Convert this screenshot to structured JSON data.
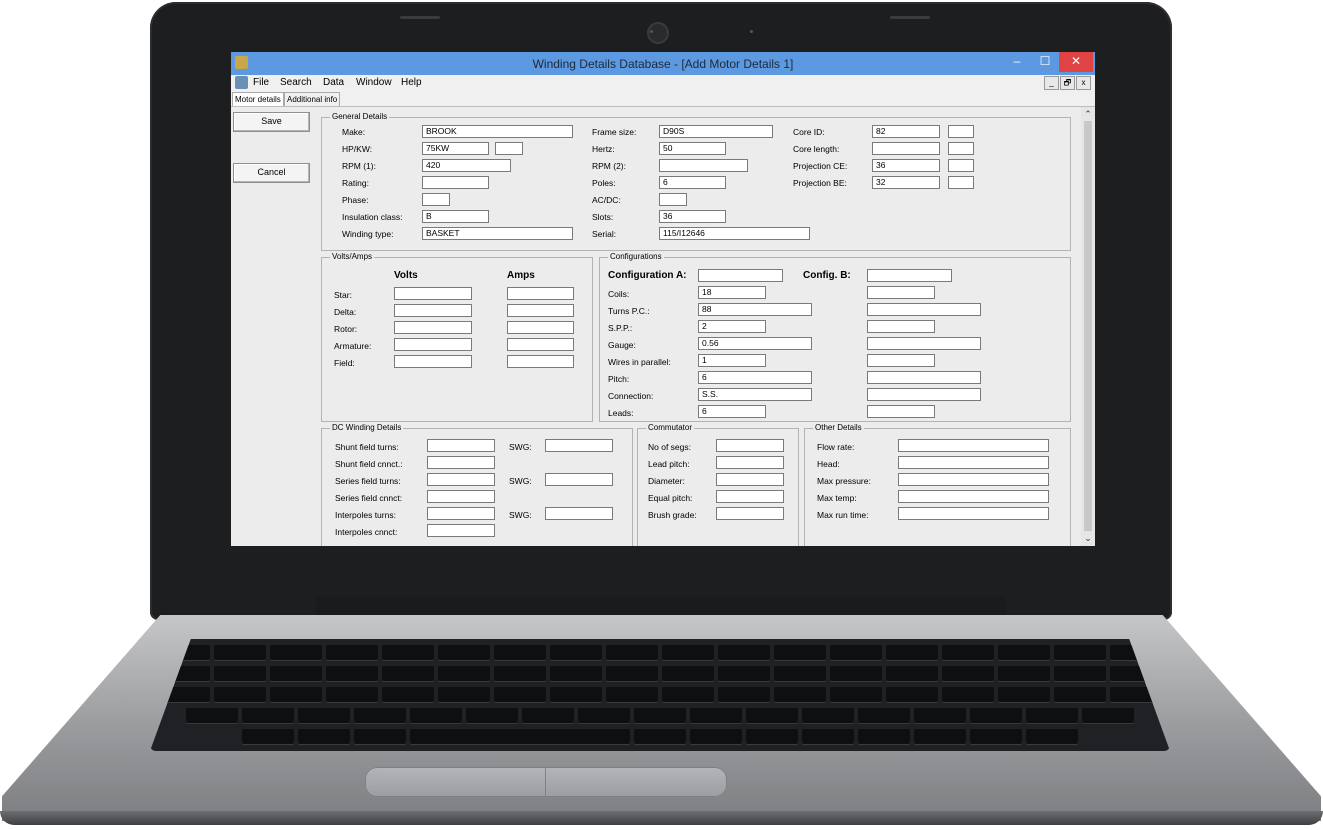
{
  "window": {
    "title": "Winding Details Database - [Add Motor Details 1]",
    "controls": {
      "minimize": "–",
      "maximize": "☐",
      "close": "✕"
    }
  },
  "menu": [
    "File",
    "Search",
    "Data",
    "Window",
    "Help"
  ],
  "mdi_controls": [
    "_",
    "🗗",
    "x"
  ],
  "tabs": [
    "Motor details",
    "Additional info"
  ],
  "buttons": {
    "save": "Save",
    "cancel": "Cancel"
  },
  "general": {
    "title": "General Details",
    "make": {
      "label": "Make:",
      "value": "BROOK"
    },
    "hpkw": {
      "label": "HP/KW:",
      "value": "75KW",
      "value2": ""
    },
    "rpm1": {
      "label": "RPM (1):",
      "value": "420"
    },
    "rating": {
      "label": "Rating:",
      "value": ""
    },
    "phase": {
      "label": "Phase:",
      "value": ""
    },
    "insulation": {
      "label": "Insulation class:",
      "value": "B"
    },
    "winding_type": {
      "label": "Winding type:",
      "value": "BASKET"
    },
    "frame_size": {
      "label": "Frame size:",
      "value": "D90S"
    },
    "hertz": {
      "label": "Hertz:",
      "value": "50"
    },
    "rpm2": {
      "label": "RPM (2):",
      "value": ""
    },
    "poles": {
      "label": "Poles:",
      "value": "6"
    },
    "acdc": {
      "label": "AC/DC:",
      "value": ""
    },
    "slots": {
      "label": "Slots:",
      "value": "36"
    },
    "serial": {
      "label": "Serial:",
      "value": "115/I12646"
    },
    "core_id": {
      "label": "Core ID:",
      "value": "82",
      "value2": ""
    },
    "core_length": {
      "label": "Core length:",
      "value": "",
      "value2": ""
    },
    "proj_ce": {
      "label": "Projection CE:",
      "value": "36",
      "value2": ""
    },
    "proj_be": {
      "label": "Projection BE:",
      "value": "32",
      "value2": ""
    }
  },
  "volts_amps": {
    "title": "Volts/Amps",
    "col_volts": "Volts",
    "col_amps": "Amps",
    "rows": [
      {
        "label": "Star:",
        "volts": "",
        "amps": ""
      },
      {
        "label": "Delta:",
        "volts": "",
        "amps": ""
      },
      {
        "label": "Rotor:",
        "volts": "",
        "amps": ""
      },
      {
        "label": "Armature:",
        "volts": "",
        "amps": ""
      },
      {
        "label": "Field:",
        "volts": "",
        "amps": ""
      }
    ]
  },
  "configurations": {
    "title": "Configurations",
    "config_a_label": "Configuration A:",
    "config_a_value": "",
    "config_b_label": "Config. B:",
    "config_b_value": "",
    "rows": [
      {
        "label": "Coils:",
        "a": "18",
        "b": ""
      },
      {
        "label": "Turns P.C.:",
        "a": "88",
        "b": ""
      },
      {
        "label": "S.P.P.:",
        "a": "2",
        "b": ""
      },
      {
        "label": "Gauge:",
        "a": "0.56",
        "b": ""
      },
      {
        "label": "Wires in parallel:",
        "a": "1",
        "b": ""
      },
      {
        "label": "Pitch:",
        "a": "6",
        "b": ""
      },
      {
        "label": "Connection:",
        "a": "S.S.",
        "b": ""
      },
      {
        "label": "Leads:",
        "a": "6",
        "b": ""
      }
    ]
  },
  "dc_winding": {
    "title": "DC Winding Details",
    "swg_label": "SWG:",
    "rows": [
      {
        "label": "Shunt field turns:",
        "value": "",
        "swg": ""
      },
      {
        "label": "Shunt field cnnct.:",
        "value": ""
      },
      {
        "label": "Series field turns:",
        "value": "",
        "swg": ""
      },
      {
        "label": "Series field cnnct:",
        "value": ""
      },
      {
        "label": "Interpoles turns:",
        "value": "",
        "swg": ""
      },
      {
        "label": "Interpoles cnnct:",
        "value": ""
      }
    ]
  },
  "commutator": {
    "title": "Commutator",
    "rows": [
      {
        "label": "No of segs:",
        "value": ""
      },
      {
        "label": "Lead pitch:",
        "value": ""
      },
      {
        "label": "Diameter:",
        "value": ""
      },
      {
        "label": "Equal pitch:",
        "value": ""
      },
      {
        "label": "Brush grade:",
        "value": ""
      }
    ]
  },
  "other": {
    "title": "Other Details",
    "rows": [
      {
        "label": "Flow rate:",
        "value": ""
      },
      {
        "label": "Head:",
        "value": ""
      },
      {
        "label": "Max pressure:",
        "value": ""
      },
      {
        "label": "Max temp:",
        "value": ""
      },
      {
        "label": "Max run time:",
        "value": ""
      }
    ]
  },
  "scrollbar": {
    "up": "⌃",
    "down": "⌄"
  },
  "colors": {
    "titlebar": "#5c99e0",
    "close": "#e04343",
    "form_bg": "#ececec"
  }
}
